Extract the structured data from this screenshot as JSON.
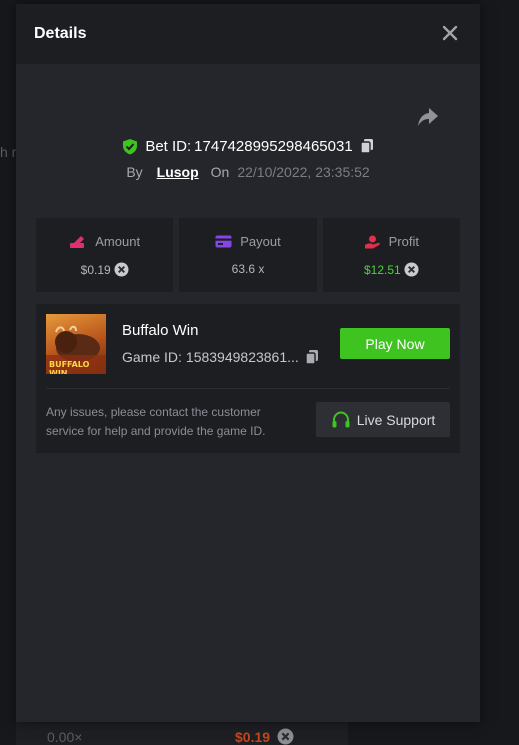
{
  "background": {
    "partial_left_text": "h r",
    "bottom_multiplier": "0.00×",
    "bottom_amount": "$0.19"
  },
  "modal": {
    "title": "Details",
    "bet": {
      "id_label": "Bet ID:",
      "id_value": "1747428995298465031",
      "by_label": "By",
      "user": "Lusop",
      "on_label": "On",
      "datetime": "22/10/2022, 23:35:52"
    },
    "stats": [
      {
        "label": "Amount",
        "value": "$0.19",
        "icon": "wallet-icon"
      },
      {
        "label": "Payout",
        "value": "63.6 x",
        "icon": "card-icon"
      },
      {
        "label": "Profit",
        "value": "$12.51",
        "icon": "hand-coin-icon"
      }
    ],
    "game": {
      "name": "Buffalo Win",
      "thumb_text": "BUFFALO WIN",
      "id_label": "Game ID:",
      "id_value": "1583949823861...",
      "play_button": "Play Now",
      "help_text": "Any issues, please contact the customer service for help and provide the game ID.",
      "support_button": "Live Support"
    }
  },
  "colors": {
    "accent_green": "#3fc321",
    "profit_green": "#4bd33c",
    "amount_bottom": "#c5451d"
  }
}
